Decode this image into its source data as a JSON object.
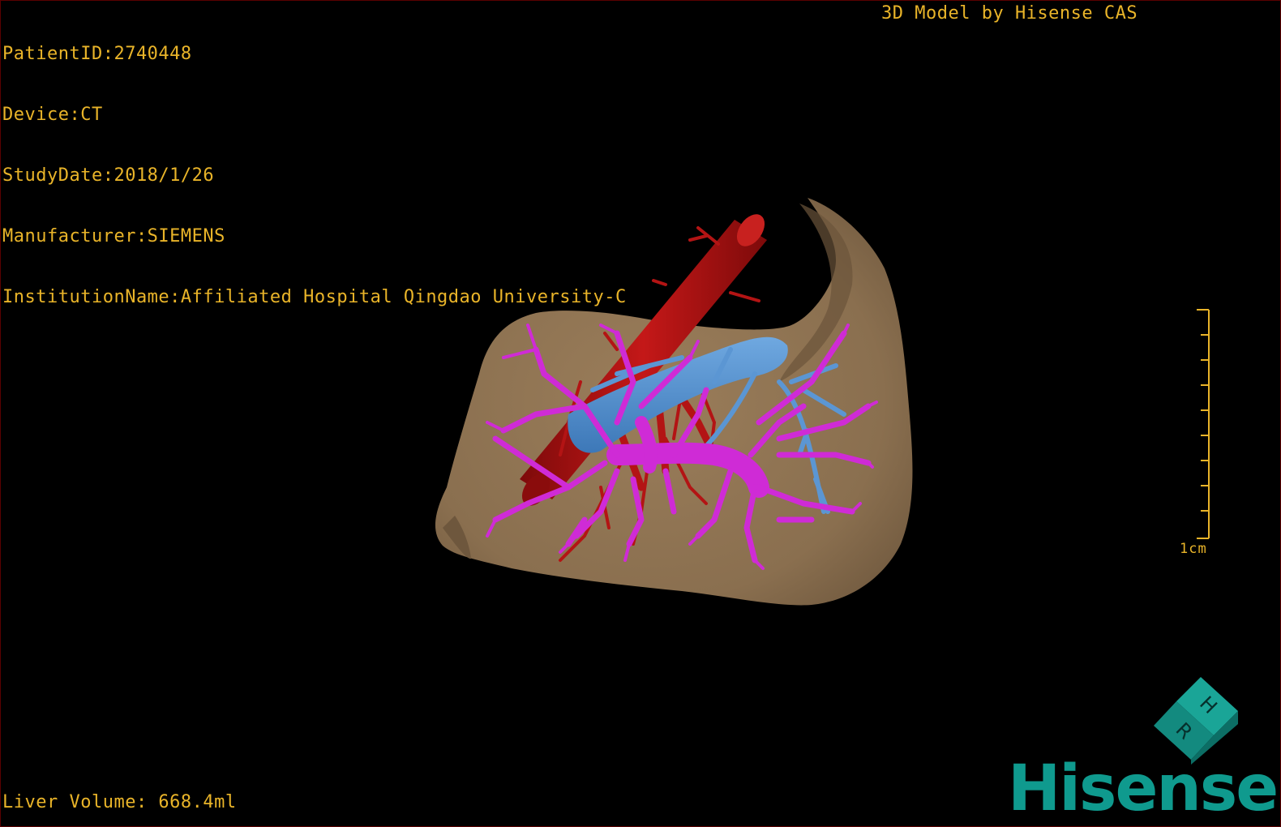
{
  "dicom_info": {
    "patient_id": "PatientID:2740448",
    "device": "Device:CT",
    "study_date": "StudyDate:2018/1/26",
    "manufacturer": "Manufacturer:SIEMENS",
    "institution": "InstitutionName:Affiliated Hospital Qingdao University-C"
  },
  "model_credit": "3D Model by Hisense CAS",
  "liver_volume": "Liver Volume: 668.4ml",
  "scale": {
    "label": "1cm"
  },
  "orientation_cube": {
    "face_top": "H",
    "face_front": "R"
  },
  "brand": "Hisense",
  "colors": {
    "overlay_text": "#e9b429",
    "liver": "#8c7150",
    "artery": "#b31414",
    "portal_vein": "#cf2bd6",
    "hepatic_vein": "#4d8fd1",
    "brand": "#0f9a8e"
  },
  "icons": {
    "orientation": "orientation-cube-icon",
    "scale": "ruler-scale-icon"
  }
}
